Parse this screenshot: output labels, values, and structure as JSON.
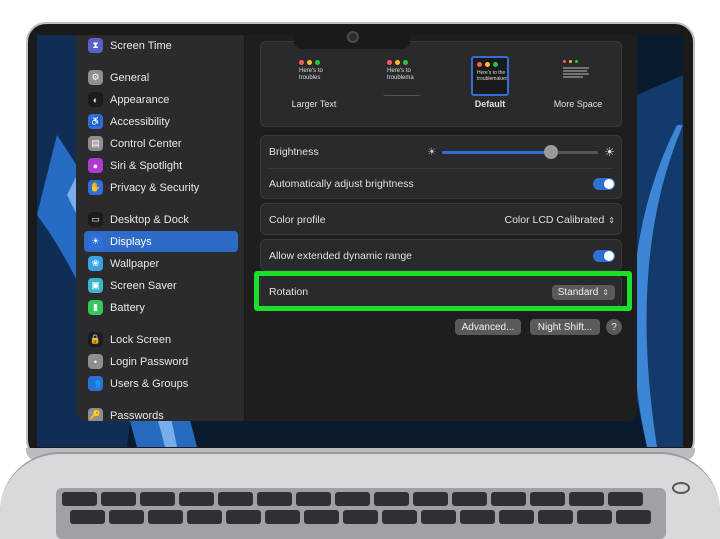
{
  "sidebar": {
    "items": [
      {
        "label": "Screen Time",
        "icon": "hourglass-icon",
        "color": "#5b5fc7"
      },
      {
        "label": "General",
        "icon": "gear-icon",
        "color": "#8e8e93"
      },
      {
        "label": "Appearance",
        "icon": "appearance-icon",
        "color": "#1c1c1e"
      },
      {
        "label": "Accessibility",
        "icon": "accessibility-icon",
        "color": "#2f6fd6"
      },
      {
        "label": "Control Center",
        "icon": "control-center-icon",
        "color": "#8e8e93"
      },
      {
        "label": "Siri & Spotlight",
        "icon": "siri-icon",
        "color": "#b03ad1"
      },
      {
        "label": "Privacy & Security",
        "icon": "hand-icon",
        "color": "#2f6fd6"
      },
      {
        "label": "Desktop & Dock",
        "icon": "desktop-icon",
        "color": "#1c1c1e"
      },
      {
        "label": "Displays",
        "icon": "sun-icon",
        "color": "#2f6fd6"
      },
      {
        "label": "Wallpaper",
        "icon": "wallpaper-icon",
        "color": "#3aa3e8"
      },
      {
        "label": "Screen Saver",
        "icon": "screen-saver-icon",
        "color": "#3ab5c9"
      },
      {
        "label": "Battery",
        "icon": "battery-icon",
        "color": "#34c759"
      },
      {
        "label": "Lock Screen",
        "icon": "lock-icon",
        "color": "#1c1c1e"
      },
      {
        "label": "Login Password",
        "icon": "password-icon",
        "color": "#8e8e93"
      },
      {
        "label": "Users & Groups",
        "icon": "users-icon",
        "color": "#2f6fd6"
      },
      {
        "label": "Passwords",
        "icon": "key-icon",
        "color": "#8e8e93"
      }
    ],
    "active": "Displays"
  },
  "resolution": {
    "options": [
      {
        "label": "Larger Text",
        "preview": "Here's to troubles"
      },
      {
        "label": "",
        "preview": "Here's to troublema"
      },
      {
        "label": "Default",
        "preview": "Here's to the troublemakers"
      },
      {
        "label": "More Space",
        "preview": ""
      }
    ],
    "selected": "Default"
  },
  "settings": {
    "brightness_label": "Brightness",
    "brightness_level": 0.7,
    "auto_brightness_label": "Automatically adjust brightness",
    "auto_brightness_on": true,
    "color_profile_label": "Color profile",
    "color_profile_value": "Color LCD Calibrated",
    "edr_label": "Allow extended dynamic range",
    "edr_on": true,
    "rotation_label": "Rotation",
    "rotation_value": "Standard"
  },
  "buttons": {
    "advanced": "Advanced...",
    "night_shift": "Night Shift...",
    "help": "?"
  },
  "colors": {
    "accent": "#2f6fd6",
    "highlight": "#1be02a",
    "dot_red": "#ff5f57",
    "dot_yellow": "#febc2e",
    "dot_green": "#28c840"
  }
}
